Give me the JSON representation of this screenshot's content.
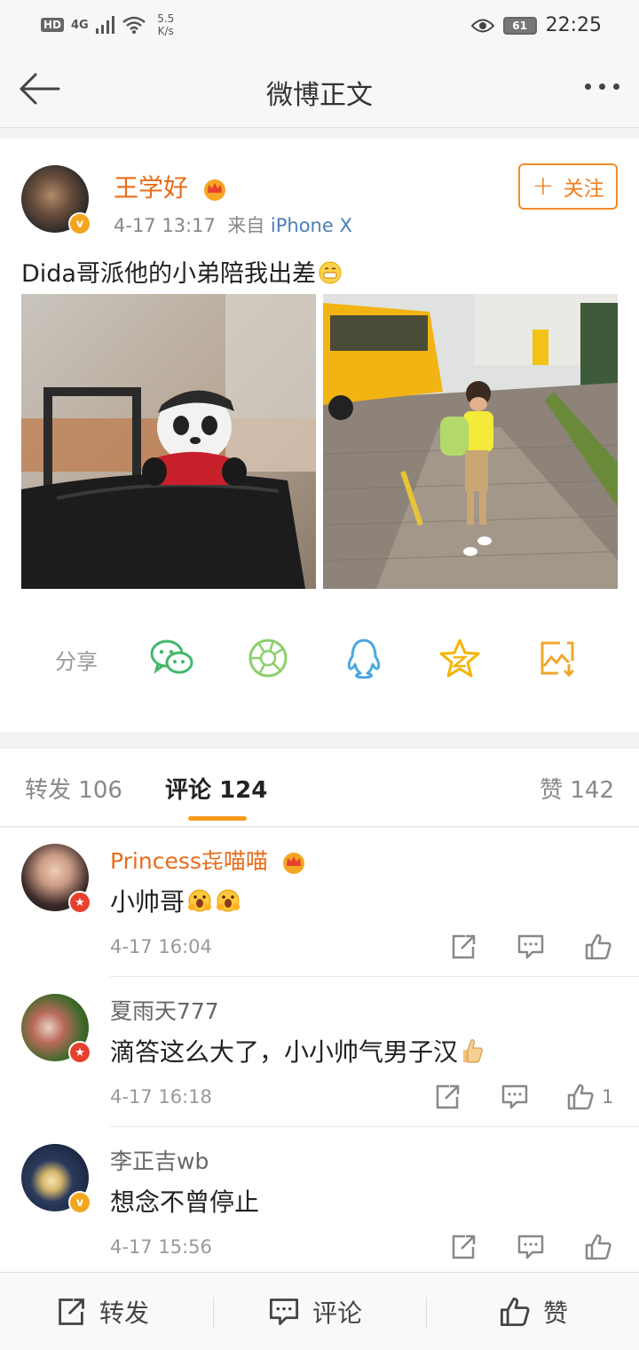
{
  "status_bar": {
    "hd": "HD",
    "signal": "4G",
    "speed_value": "5.5",
    "speed_unit": "K/s",
    "battery": "61",
    "time": "22:25"
  },
  "header": {
    "title": "微博正文"
  },
  "post": {
    "author": "王学好",
    "time": "4-17 13:17",
    "source_prefix": "来自",
    "source": "iPhone X",
    "follow_label": "关注",
    "text": "Dida哥派他的小弟陪我出差",
    "share_label": "分享",
    "share_icons": [
      "wechat-icon",
      "moments-icon",
      "qq-icon",
      "qzone-star-icon",
      "save-image-icon"
    ]
  },
  "tabs": {
    "repost": {
      "label": "转发",
      "count": "106"
    },
    "comment": {
      "label": "评论",
      "count": "124"
    },
    "like": {
      "label": "赞",
      "count": "142"
    }
  },
  "comments": [
    {
      "name": "Princess㐂喵喵",
      "text": "小帅哥",
      "time": "4-17 16:04",
      "likes": ""
    },
    {
      "name": "夏雨天777",
      "text": "滴答这么大了，小小帅气男子汉",
      "time": "4-17 16:18",
      "likes": "1"
    },
    {
      "name": "李正吉wb",
      "text": "想念不曾停止",
      "time": "4-17 15:56",
      "likes": ""
    }
  ],
  "bottom_bar": {
    "repost": "转发",
    "comment": "评论",
    "like": "赞"
  },
  "colors": {
    "accent": "#f07e1c",
    "name_orange": "#e86c1a",
    "link_blue": "#4a7fb8",
    "tab_underline": "#f79a1e"
  }
}
